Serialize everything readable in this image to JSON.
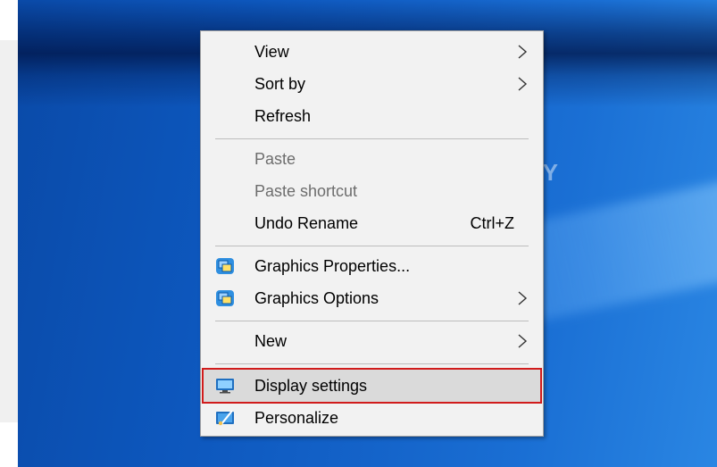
{
  "context_menu": {
    "items": [
      {
        "label": "View",
        "shortcut": "",
        "submenu": true,
        "disabled": false
      },
      {
        "label": "Sort by",
        "shortcut": "",
        "submenu": true,
        "disabled": false
      },
      {
        "label": "Refresh",
        "shortcut": "",
        "submenu": false,
        "disabled": false
      },
      {
        "label": "Paste",
        "shortcut": "",
        "submenu": false,
        "disabled": true
      },
      {
        "label": "Paste shortcut",
        "shortcut": "",
        "submenu": false,
        "disabled": true
      },
      {
        "label": "Undo Rename",
        "shortcut": "Ctrl+Z",
        "submenu": false,
        "disabled": false
      },
      {
        "label": "Graphics Properties...",
        "shortcut": "",
        "submenu": false,
        "disabled": false,
        "icon": "intel-graphics-icon"
      },
      {
        "label": "Graphics Options",
        "shortcut": "",
        "submenu": true,
        "disabled": false,
        "icon": "intel-graphics-icon"
      },
      {
        "label": "New",
        "shortcut": "",
        "submenu": true,
        "disabled": false
      },
      {
        "label": "Display settings",
        "shortcut": "",
        "submenu": false,
        "disabled": false,
        "icon": "monitor-icon",
        "highlighted": true
      },
      {
        "label": "Personalize",
        "shortcut": "",
        "submenu": false,
        "disabled": false,
        "icon": "personalize-icon"
      }
    ]
  },
  "watermark": "UNIFY",
  "colors": {
    "menu_bg": "#f2f2f2",
    "highlight_bg": "#dadada",
    "highlight_outline": "#d11c1c",
    "desktop_blue": "#0d57bd"
  }
}
